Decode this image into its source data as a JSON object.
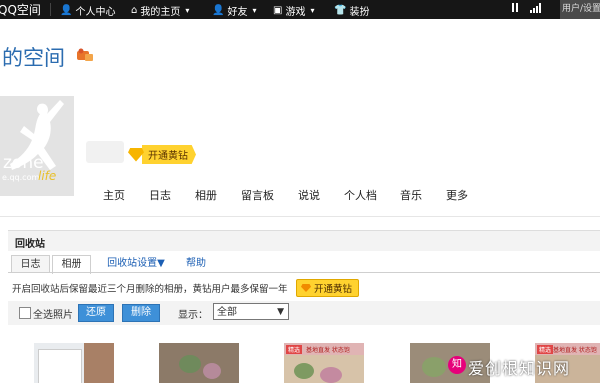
{
  "topbar": {
    "logo": "QQ空间",
    "items": [
      {
        "label": "个人中心",
        "icon": "person-icon"
      },
      {
        "label": "我的主页",
        "icon": "home-icon"
      },
      {
        "label": "好友",
        "icon": "friends-icon"
      },
      {
        "label": "游戏",
        "icon": "gamepad-icon"
      },
      {
        "label": "装扮",
        "icon": "shirt-icon"
      }
    ],
    "user_menu": "用户/设置"
  },
  "space": {
    "title": "的空间",
    "avatar": {
      "zone_text": "zone",
      "url_text": "e.qq.com",
      "life_text": "life"
    },
    "vip_badge": "开通黄钻"
  },
  "nav": [
    "主页",
    "日志",
    "相册",
    "留言板",
    "说说",
    "个人档",
    "音乐",
    "更多"
  ],
  "recycle": {
    "title": "回收站",
    "tabs": [
      "日志",
      "相册",
      "回收站设置▼",
      "帮助"
    ],
    "notice": "开启回收站后保留最近三个月删除的相册，黄钻用户最多保留一年",
    "vip_button": "开通黄钻",
    "select_all": "全选照片",
    "restore_button": "还原",
    "delete_button": "删除",
    "display_label": "显示：",
    "display_value": "全部"
  },
  "thumbnails": [
    {
      "tag": "",
      "caption": ""
    },
    {
      "tag": "",
      "caption": ""
    },
    {
      "tag": "精选",
      "caption": "基地直发 状态饱"
    },
    {
      "tag": "",
      "caption": ""
    },
    {
      "tag": "精选",
      "caption": "基地直发 状态饱"
    }
  ],
  "watermark": "爱创根知识网",
  "colors": {
    "accent": "#2b6cb0",
    "button": "#3e90d8",
    "vip": "#ffd22f",
    "topbar": "#161616"
  }
}
